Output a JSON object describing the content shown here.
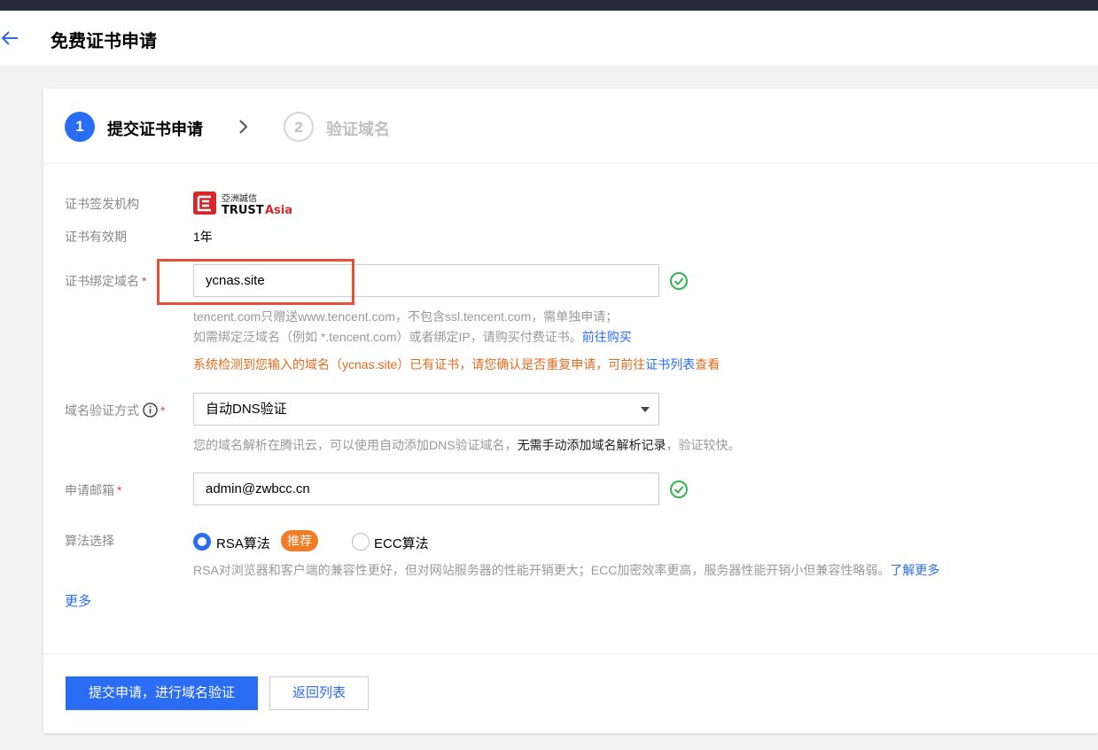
{
  "header": {
    "title": "免费证书申请"
  },
  "steps": [
    {
      "num": "1",
      "label": "提交证书申请"
    },
    {
      "num": "2",
      "label": "验证域名"
    }
  ],
  "issuer": {
    "label": "证书签发机构",
    "logo_text": "亞洲誠信 TRUSTAsia"
  },
  "validity": {
    "label": "证书有效期",
    "value": "1年"
  },
  "domain": {
    "label": "证书绑定域名",
    "value": "ycnas.site",
    "hint1": "tencent.com只赠送www.tencent.com，不包含ssl.tencent.com，需单独申请；",
    "hint2": "如需绑定泛域名（例如 *.tencent.com）或者绑定IP，请购买付费证书。",
    "hint2_link": "前往购买",
    "warning": "系统检测到您输入的域名（ycnas.site）已有证书，请您确认是否重复申请，可前往",
    "warning_link": "证书列表",
    "warning_tail": "查看"
  },
  "verify_method": {
    "label": "域名验证方式",
    "value": "自动DNS验证",
    "hint_pre": "您的域名解析在腾讯云，可以使用自动添加DNS验证域名，",
    "hint_strong": "无需手动添加域名解析记录",
    "hint_post": "，验证较快。"
  },
  "email": {
    "label": "申请邮箱",
    "value": "admin@zwbcc.cn"
  },
  "algorithm": {
    "label": "算法选择",
    "option1": "RSA算法",
    "badge": "推荐",
    "option2": "ECC算法",
    "hint": "RSA对浏览器和客户端的兼容性更好，但对网站服务器的性能开销更大；ECC加密效率更高，服务器性能开销小但兼容性略弱。",
    "hint_link": "了解更多"
  },
  "more": "更多",
  "buttons": {
    "submit": "提交申请，进行域名验证",
    "back": "返回列表"
  },
  "colors": {
    "accent": "#2b6cf5",
    "warning": "#e16c1f",
    "success": "#2fb64f",
    "highlight": "#e9503c"
  }
}
